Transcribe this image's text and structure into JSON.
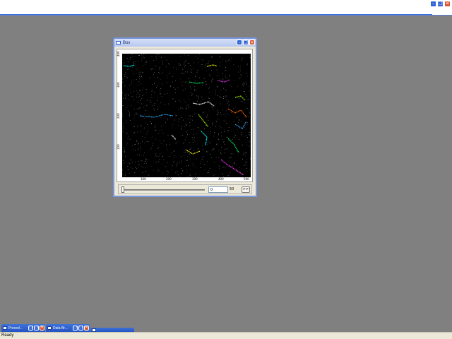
{
  "app_bar": {
    "controls": {
      "minimize": "–",
      "restore": "❐",
      "close": "✕"
    }
  },
  "image_window": {
    "title": "Box",
    "controls": {
      "minimize": "–",
      "restore": "❐",
      "close": "✕"
    },
    "axes": {
      "x_ticks": [
        "100",
        "200",
        "300",
        "400",
        "500"
      ],
      "y_ticks": [
        "100",
        "200",
        "300",
        "400"
      ]
    },
    "playback": {
      "slider_value": 0,
      "frame_input": "0",
      "frame_total": "50",
      "play_label": ">>"
    }
  },
  "minimized_windows": [
    {
      "label": "Proced..."
    },
    {
      "label": "Data Br..."
    },
    {
      "label": ""
    }
  ],
  "status_bar": {
    "text": "Ready"
  },
  "colors": {
    "desktop": "#808080",
    "title_blue": "#2f63d6",
    "close_red": "#d9532f",
    "plot_bg": "#000000"
  }
}
